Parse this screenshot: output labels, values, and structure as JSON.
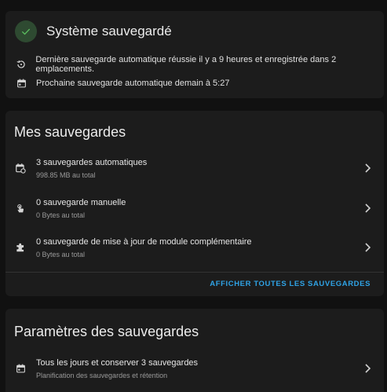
{
  "status": {
    "title": "Système sauvegardé",
    "last_backup": "Dernière sauvegarde automatique réussie il y a 9 heures et enregistrée dans 2 emplacements.",
    "next_backup": "Prochaine sauvegarde automatique demain à 5:27"
  },
  "backups": {
    "title": "Mes sauvegardes",
    "items": [
      {
        "label": "3 sauvegardes automatiques",
        "sub": "998.85 MB au total",
        "icon": "calendar-sync-icon"
      },
      {
        "label": "0 sauvegarde manuelle",
        "sub": "0 Bytes au total",
        "icon": "gesture-tap-icon"
      },
      {
        "label": "0 sauvegarde de mise à jour de module complémentaire",
        "sub": "0 Bytes au total",
        "icon": "puzzle-icon"
      }
    ],
    "show_all": "AFFICHER TOUTES LES SAUVEGARDES"
  },
  "settings": {
    "title": "Paramètres des sauvegardes",
    "schedule_label": "Tous les jours et conserver 3 sauvegardes",
    "schedule_sub": "Planification des sauvegardes et rétention"
  },
  "colors": {
    "background": "#111111",
    "card": "#1c1c1c",
    "accent": "#2fa3e6",
    "success": "#4caf50"
  }
}
